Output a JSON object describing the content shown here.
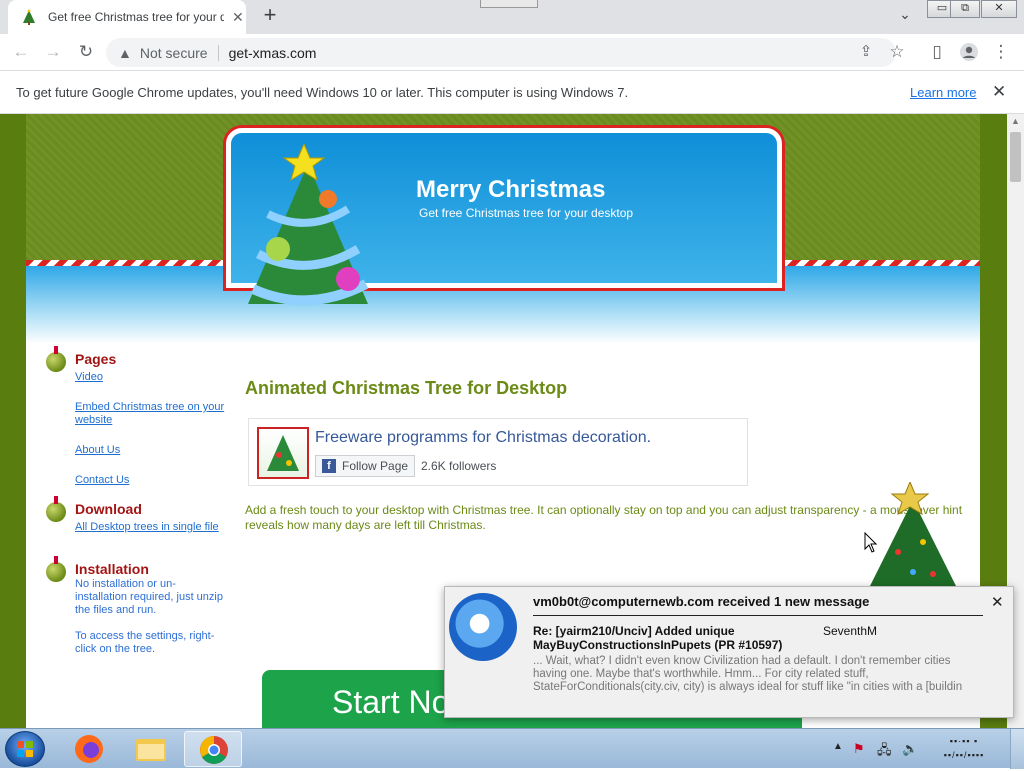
{
  "browser": {
    "tab_title": "Get free Christmas tree for your d",
    "tab_close": "✕",
    "new_tab": "+",
    "window": {
      "minimize": "▭",
      "restore": "⧉",
      "close": "✕"
    },
    "omnibox": {
      "security": "Not secure",
      "url": "get-xmas.com"
    },
    "infobar": {
      "message": "To get future Google Chrome updates, you'll need Windows 10 or later. This computer is using Windows 7.",
      "link": "Learn more",
      "close": "✕"
    }
  },
  "site": {
    "banner": {
      "title": "Merry Christmas",
      "subtitle": "Get free Christmas tree for your desktop"
    },
    "sidebar": {
      "pages": {
        "heading": "Pages",
        "links": [
          "Video",
          "Embed Christmas tree on your website",
          "About Us",
          "Contact Us"
        ]
      },
      "download": {
        "heading": "Download",
        "link": "All Desktop trees in single file"
      },
      "installation": {
        "heading": "Installation",
        "text1": "No installation or un-installation required, just unzip the files and run.",
        "text2": "To access the settings, right-click on the tree."
      }
    },
    "main": {
      "title": "Animated Christmas Tree for Desktop",
      "facebook": {
        "page_name": "Freeware programms for Christmas decoration.",
        "follow": "Follow Page",
        "followers": "2.6K followers"
      },
      "description": "Add a fresh touch to your desktop with Christmas tree. It can optionally stay on top and you can adjust transparency - a mouseover hint reveals how many days are left till Christmas.",
      "start_button": "Start No"
    }
  },
  "notification": {
    "header": "vm0b0t@computernewb.com received 1 new message",
    "subject": "Re: [yairm210/Unciv] Added unique MayBuyConstructionsInPupets (PR #10597)",
    "sender": "SeventhM",
    "preview": "... Wait, what? I didn't even know Civilization had a default. I don't remember cities having one. Maybe that's worthwhile. Hmm... For city related stuff, StateForConditionals(city.civ, city) is always ideal for stuff like \"in cities with a [buildin",
    "close": "✕"
  },
  "taskbar": {
    "apps": [
      "firefox",
      "file-explorer",
      "chrome"
    ]
  }
}
